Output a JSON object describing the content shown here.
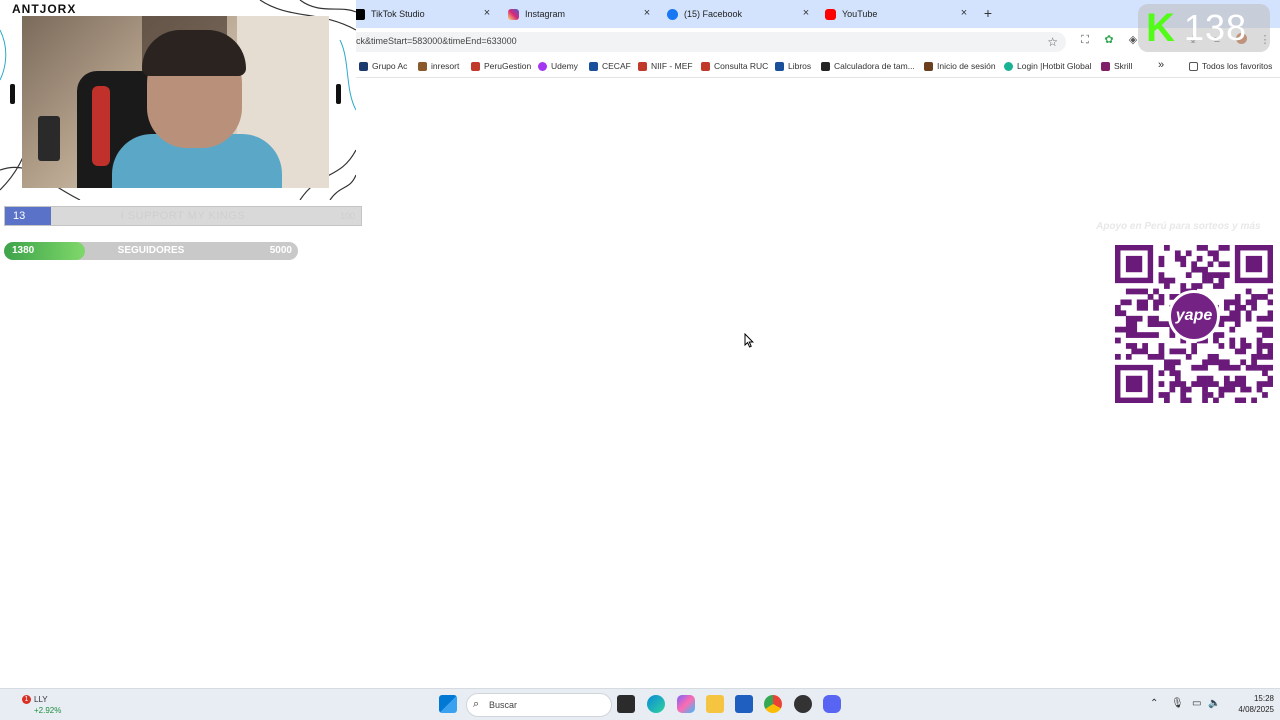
{
  "browser": {
    "tabs": [
      {
        "label": "TikTok Studio",
        "icon": "tiktok-icon",
        "color": "#000000"
      },
      {
        "label": "Instagram",
        "icon": "instagram-icon",
        "color": "#d62976"
      },
      {
        "label": "(15) Facebook",
        "icon": "facebook-icon",
        "color": "#1877f2"
      },
      {
        "label": "YouTube",
        "icon": "youtube-icon",
        "color": "#ff0000"
      }
    ],
    "new_tab": "+",
    "close_glyph": "×",
    "url": "ck&timeStart=583000&timeEnd=633000",
    "bookmarks": [
      {
        "label": "Grupo Ac",
        "color": "#1b3b6f"
      },
      {
        "label": "inresort",
        "color": "#8a5a2b"
      },
      {
        "label": "PeruGestion",
        "color": "#c0392b"
      },
      {
        "label": "Udemy",
        "color": "#a435f0"
      },
      {
        "label": "CECAF",
        "color": "#1a4f9c"
      },
      {
        "label": "NIIF - MEF",
        "color": "#c0392b"
      },
      {
        "label": "Consulta RUC",
        "color": "#c0392b"
      },
      {
        "label": "Libros",
        "color": "#1a4f9c"
      },
      {
        "label": "Calculadora de tam...",
        "color": "#222222"
      },
      {
        "label": "Inicio de sesión",
        "color": "#6b3e1e"
      },
      {
        "label": "Login |Hotbit Global",
        "color": "#19b394"
      },
      {
        "label": "Skrill",
        "color": "#811e68"
      }
    ],
    "more_bookmarks": "»",
    "all_bookmarks": "Todos los favoritos"
  },
  "overlay": {
    "brand": "ANTJORX",
    "goal_support": {
      "current": "13",
      "label": "I SUPPORT MY KINGS",
      "max": "100",
      "progress": 0.13,
      "color": "#5a73c8"
    },
    "goal_followers": {
      "current": "1380",
      "label": "SEGUIDORES",
      "max": "5000",
      "progress": 0.276,
      "color": "#3ea34a"
    },
    "kick_viewers": "138",
    "yape_caption": "Apoyo en Perú para sorteos y más",
    "yape_badge": "yape"
  },
  "taskbar": {
    "ticker": "LLY",
    "ticker_change": "+2.92%",
    "notif_count": "1",
    "search_placeholder": "Buscar",
    "time": "15:28",
    "date": "4/08/2025"
  }
}
